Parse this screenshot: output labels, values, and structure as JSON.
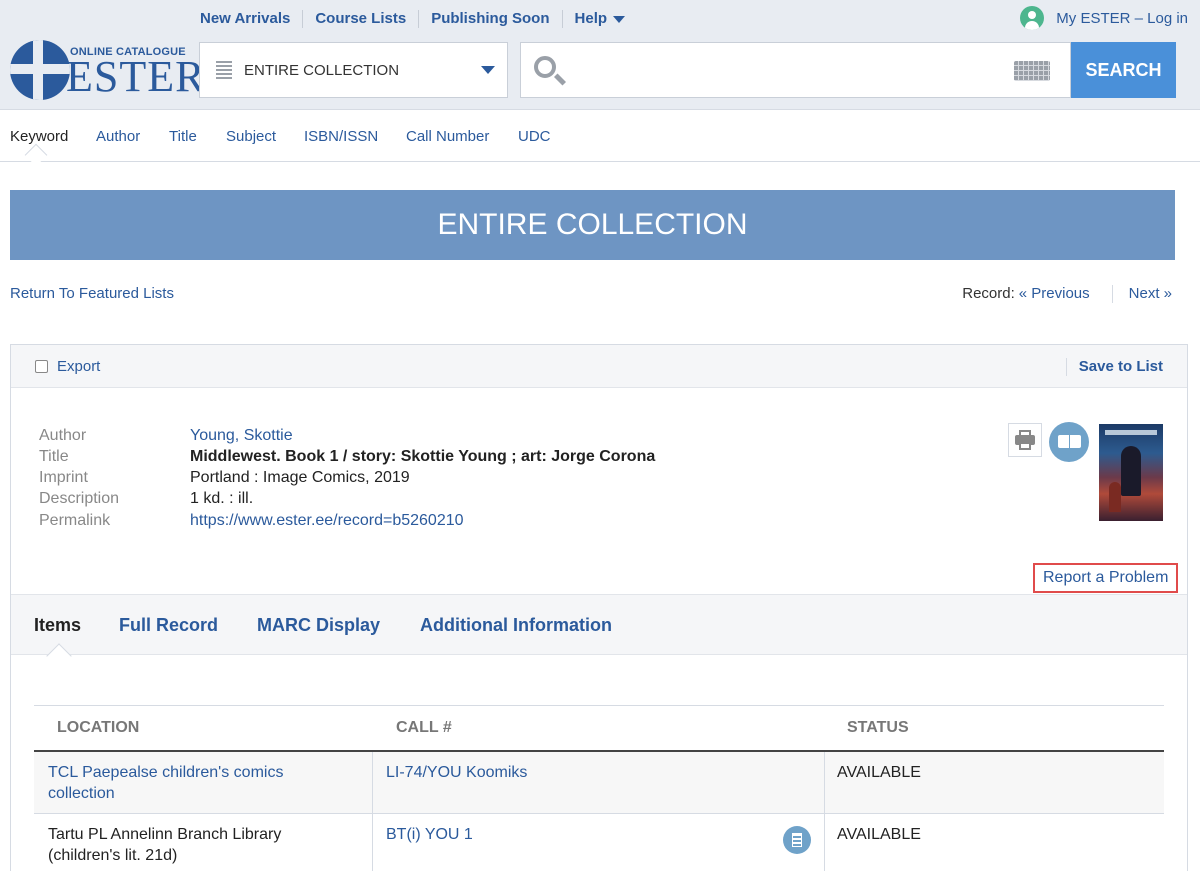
{
  "header": {
    "nav": [
      "New Arrivals",
      "Course Lists",
      "Publishing Soon",
      "Help"
    ],
    "login": "My ESTER – Log in",
    "logo_sub": "ONLINE CATALOGUE",
    "logo_main": "ESTER",
    "scope": "ENTIRE COLLECTION",
    "search_value": "",
    "search_button": "SEARCH"
  },
  "search_tabs": [
    "Keyword",
    "Author",
    "Title",
    "Subject",
    "ISBN/ISSN",
    "Call Number",
    "UDC"
  ],
  "banner": "ENTIRE COLLECTION",
  "return_link": "Return To Featured Lists",
  "record_nav": {
    "label": "Record:",
    "previous": "« Previous",
    "next": "Next »"
  },
  "toolbar": {
    "export": "Export",
    "save": "Save to List"
  },
  "record": {
    "labels": [
      "Author",
      "Title",
      "Imprint",
      "Description",
      "Permalink"
    ],
    "author": "Young, Skottie",
    "title": "Middlewest. Book 1 / story: Skottie Young ; art: Jorge Corona",
    "imprint": "Portland : Image Comics, 2019",
    "description": "1 kd. : ill.",
    "permalink": "https://www.ester.ee/record=b5260210"
  },
  "report": "Report a Problem",
  "item_tabs": [
    "Items",
    "Full Record",
    "MARC Display",
    "Additional Information"
  ],
  "items": {
    "headers": [
      "LOCATION",
      "CALL #",
      "STATUS"
    ],
    "rows": [
      {
        "location": "TCL Paepealse children's comics collection",
        "call": "LI-74/YOU Koomiks",
        "status": "AVAILABLE"
      },
      {
        "location": "Tartu PL Annelinn Branch Library (children's lit. 21d)",
        "call": "BT(i) YOU 1",
        "status": "AVAILABLE"
      }
    ]
  },
  "colors": {
    "accent": "#2b5a9c",
    "banner": "#6e95c3",
    "search_button": "#4a90d9",
    "report_border": "#e04b4b"
  }
}
